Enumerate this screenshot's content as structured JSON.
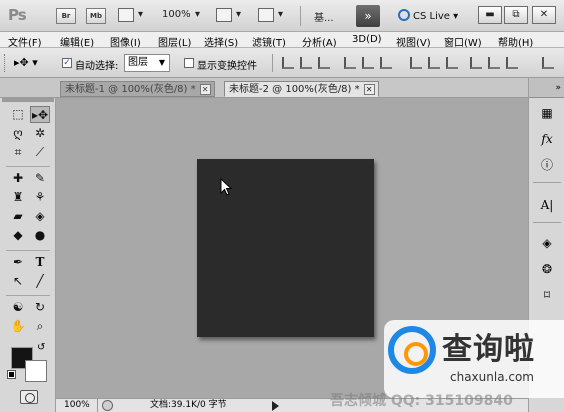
{
  "appbar": {
    "logo": "Ps",
    "br": "Br",
    "mb": "Mb",
    "zoom": "100%",
    "workspace": "基...",
    "more": "»",
    "cslive": "CS Live"
  },
  "menu": [
    "文件(F)",
    "编辑(E)",
    "图像(I)",
    "图层(L)",
    "选择(S)",
    "滤镜(T)",
    "分析(A)",
    "3D(D)",
    "视图(V)",
    "窗口(W)",
    "帮助(H)"
  ],
  "options": {
    "auto_select_label": "自动选择:",
    "auto_select_checked": true,
    "auto_select_value": "图层",
    "show_transform_label": "显示变换控件",
    "show_transform_checked": false
  },
  "tabs": [
    {
      "label": "未标题-1 @ 100%(灰色/8) *",
      "active": false
    },
    {
      "label": "未标题-2 @ 100%(灰色/8) *",
      "active": true
    }
  ],
  "status": {
    "zoom": "100%",
    "doc_info": "文档:39.1K/0 字节"
  },
  "colors": {
    "foreground": "#141414",
    "background": "#ffffff",
    "canvas": "#2b2b2b"
  },
  "watermark": {
    "brand_cn": "查询啦",
    "brand_url": "chaxunla.com",
    "overlay_text": "吾志倾城 QQ: 315109840"
  }
}
